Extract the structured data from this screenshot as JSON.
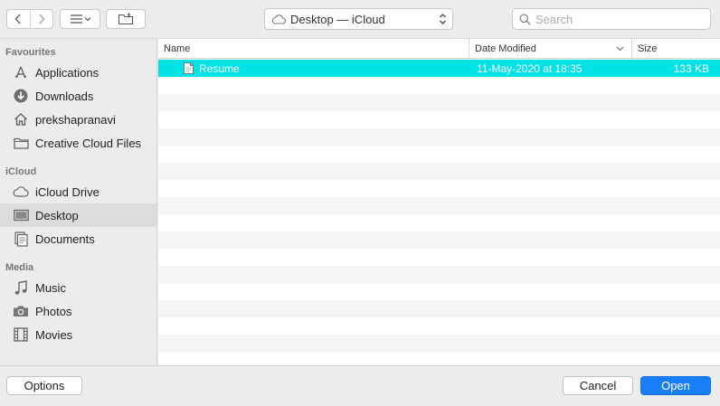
{
  "toolbar": {
    "location": "Desktop — iCloud",
    "search_placeholder": "Search"
  },
  "sidebar": {
    "sections": [
      {
        "heading": "Favourites",
        "items": [
          {
            "label": "Applications",
            "icon": "applications-icon"
          },
          {
            "label": "Downloads",
            "icon": "downloads-icon"
          },
          {
            "label": "prekshapranavi",
            "icon": "home-icon"
          },
          {
            "label": "Creative Cloud Files",
            "icon": "folder-icon"
          }
        ]
      },
      {
        "heading": "iCloud",
        "items": [
          {
            "label": "iCloud Drive",
            "icon": "cloud-icon"
          },
          {
            "label": "Desktop",
            "icon": "desktop-icon",
            "selected": true
          },
          {
            "label": "Documents",
            "icon": "documents-icon"
          }
        ]
      },
      {
        "heading": "Media",
        "items": [
          {
            "label": "Music",
            "icon": "music-icon"
          },
          {
            "label": "Photos",
            "icon": "camera-icon"
          },
          {
            "label": "Movies",
            "icon": "film-icon"
          }
        ]
      }
    ]
  },
  "list": {
    "columns": {
      "name": "Name",
      "date": "Date Modified",
      "size": "Size"
    },
    "files": [
      {
        "name": "Resume",
        "date": "11-May-2020 at 18:35",
        "size": "133 KB",
        "selected": true
      }
    ]
  },
  "footer": {
    "options_label": "Options",
    "cancel_label": "Cancel",
    "open_label": "Open"
  },
  "colors": {
    "selection": "#00e3e6",
    "primary_button": "#1a7ff6"
  }
}
